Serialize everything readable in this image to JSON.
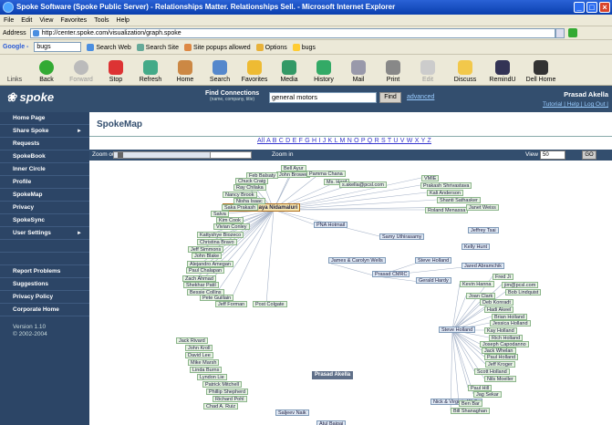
{
  "window": {
    "title": "Spoke Software (Spoke Public Server) - Relationships Matter. Relationships Sell. - Microsoft Internet Explorer"
  },
  "menu": [
    "File",
    "Edit",
    "View",
    "Favorites",
    "Tools",
    "Help"
  ],
  "address": {
    "label": "Address",
    "url": "http://center.spoke.com/visualization/graph.spoke"
  },
  "googlebar": {
    "logo": "Google -",
    "query": "bugs",
    "search_web": "Search Web",
    "search_site": "Search Site",
    "popups": "Site popups allowed",
    "options": "Options",
    "bugs": "bugs"
  },
  "toolbar": {
    "links": "Links",
    "buttons": [
      "Back",
      "Forward",
      "Stop",
      "Refresh",
      "Home",
      "Search",
      "Favorites",
      "Media",
      "History",
      "Mail",
      "Print",
      "Edit",
      "Discuss",
      "RemindU",
      "Dell Home"
    ]
  },
  "site": {
    "logo": "spoke",
    "find_connections": "Find Connections",
    "find_hint": "(name, company, title)",
    "search_value": "general motors",
    "find_button": "Find",
    "advanced": "advanced",
    "user_name": "Prasad Akella",
    "user_links": "Tutorial | Help | Log Out |"
  },
  "sidebar": {
    "items": [
      "Home Page",
      "Share Spoke",
      "Requests",
      "SpokeBook",
      "Inner Circle",
      "Profile",
      "SpokeMap",
      "Privacy",
      "SpokeSync",
      "User Settings"
    ],
    "items2": [
      "Report Problems",
      "Suggestions",
      "Privacy Policy",
      "Corporate Home"
    ],
    "version": "Version 1.10",
    "copyright": "© 2002-2004"
  },
  "main": {
    "title": "SpokeMap",
    "alphabet": "All A B C D E F G H I J K L M N O P Q R S T U V W X Y Z",
    "zoom_out": "Zoom out",
    "zoom_in": "Zoom in",
    "view_label": "View",
    "view_value": "50",
    "go": "GO"
  },
  "map": {
    "center_node": "Nagesh & Vijaya Nidamaluri",
    "hub_label": "Prasad Akella",
    "mid_nodes": [
      "PNA Hotmail",
      "Samy Uthirasamy",
      "James & Carolyn Wells",
      "Steve Holland",
      "Prasad CMRC",
      "Gerald Hardy",
      "Jeffrey Tsai",
      "Kelly Hunt",
      "Jared Abramchik",
      "Steve Holland",
      "Nick & Virginia Wells",
      "Saljeev Naik",
      "Atul Bajpai"
    ],
    "top_right_nodes": [
      "VMIE",
      "Prakash Shrivastava",
      "Kali Anderson",
      "Shanti Sathasker",
      "Roland Menassa",
      "Janet Weiss"
    ],
    "left_cluster": [
      "Bell Ayur",
      "John Brower",
      "Feb Balsaty",
      "Pamma Chana",
      "Chuck Craig",
      "Ray Chilaka",
      "Nancy Brook",
      "Nisha Isaac",
      "Saka Prakash",
      "Salva",
      "Kim Cook",
      "Vivian Conley",
      "Kattyshye Biozeco",
      "Christina Bravo",
      "Jeff Simmons",
      "John Blake",
      "Alejandro Amegan",
      "Paul Chalapan",
      "Zach Ahmad",
      "Shekhar Patil",
      "Bessie Collins",
      "Pete Guillain",
      "Jeff Forman",
      "Post Colgate",
      "Ms. Hard",
      "s.akella@pcsl.com"
    ],
    "right_cluster": [
      "Fred Ji",
      "Kevin Hanna",
      "jim@pcsl.com",
      "Bob Lindquist",
      "Joan Clark",
      "Deb Konradt",
      "Hadi Akeel",
      "Brian Holland",
      "Jessica Holland",
      "Kay Holland",
      "Rich Holland",
      "Joseph Capodanno",
      "Jack Whelan",
      "Paul Holland",
      "Jeff Kroger",
      "Scott Holland",
      "Nils Moeller",
      "Paul Hill",
      "Jag Sekar",
      "Ben Bar",
      "Bill Shanaghan"
    ],
    "bottom_left_nodes": [
      "Jack Rivard",
      "John Kroll",
      "David Lee",
      "Mike Marsh",
      "Linda Burns",
      "Lyndon Lie",
      "Patrick Mitchell",
      "Phillip Shepherd",
      "Richard Pohl",
      "Chad A. Ruiz"
    ]
  }
}
